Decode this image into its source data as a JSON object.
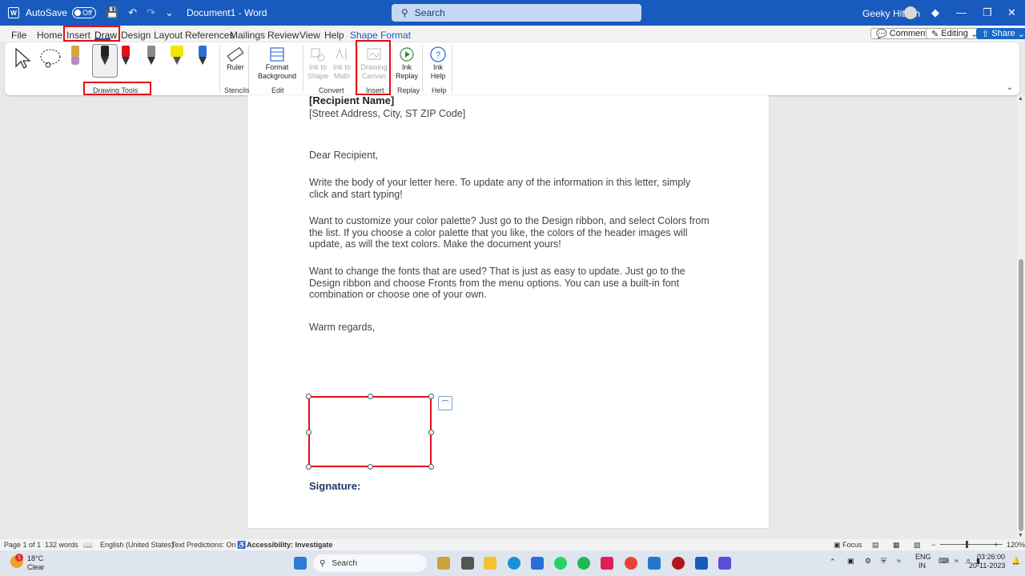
{
  "titlebar": {
    "autosave_label": "AutoSave",
    "autosave_state": "Off",
    "document_title": "Document1 - Word",
    "search_placeholder": "Search",
    "user_name": "Geeky Hitesh"
  },
  "menu": {
    "tabs": [
      "File",
      "Home",
      "Insert",
      "Draw",
      "Design",
      "Layout",
      "References",
      "Mailings",
      "Review",
      "View",
      "Help",
      "Shape Format"
    ],
    "comments": "Comments",
    "editing": "Editing",
    "share": "Share"
  },
  "ribbon": {
    "groups": {
      "drawing_tools": "Drawing Tools",
      "stencils": "Stencils",
      "edit": "Edit",
      "convert": "Convert",
      "insert": "Insert",
      "replay": "Replay",
      "help": "Help"
    },
    "ruler": "Ruler",
    "format_background": "Format Background",
    "ink_to_shape": "Ink to Shape",
    "ink_to_math": "Ink to Math",
    "drawing_canvas": "Drawing Canvas",
    "ink_replay": "Ink Replay",
    "ink_help": "Ink Help",
    "pen_colors": [
      "#d4a83a",
      "#222222",
      "#e0101c",
      "#8a8a8a",
      "#f2e600",
      "#2b6fd6"
    ]
  },
  "document": {
    "recipient_name": "[Recipient Name]",
    "recipient_address": "[Street Address, City, ST ZIP Code]",
    "salutation": "Dear Recipient,",
    "para1": "Write the body of your letter here.  To update any of the information in this letter, simply click and start typing!",
    "para2": "Want to customize your color palette?  Just go to the Design ribbon, and select Colors from the list.  If you choose a color palette that you like, the colors of the header images will update, as will the text colors.  Make the document yours!",
    "para3": "Want to change the fonts that are used?  That is just as easy to update.  Just go to the Design ribbon and choose Fronts from the menu options.  You can use a built-in font combination or choose one of your own.",
    "closing": "Warm regards,",
    "signature_label": "Signature:"
  },
  "statusbar": {
    "page": "Page 1 of 1",
    "words": "132 words",
    "language": "English (United States)",
    "text_predictions": "Text Predictions: On",
    "accessibility": "Accessibility: Investigate",
    "focus": "Focus",
    "zoom": "120%"
  },
  "taskbar": {
    "weather_temp": "18°C",
    "weather_desc": "Clear",
    "weather_badge": "1",
    "search": "Search",
    "lang_line1": "ENG",
    "lang_line2": "IN",
    "time": "03:26:00",
    "date": "20-11-2023"
  }
}
